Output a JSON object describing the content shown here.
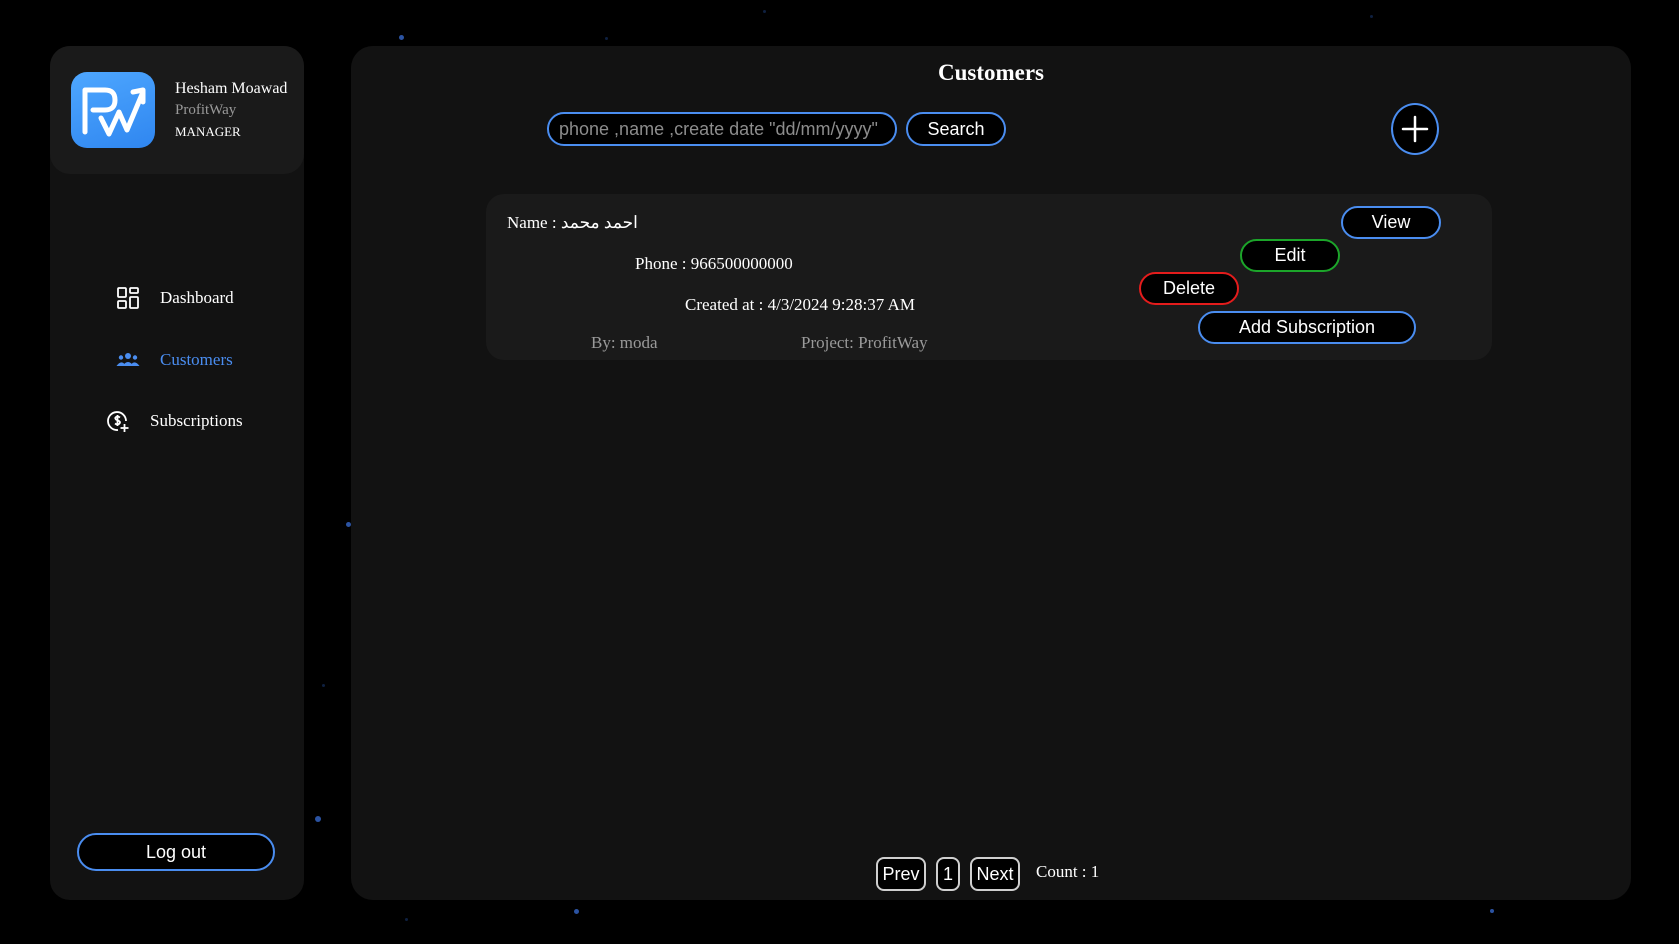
{
  "profile": {
    "name": "Hesham Moawad",
    "project": "ProfitWay",
    "role": "MANAGER"
  },
  "nav": {
    "items": [
      {
        "label": "Dashboard",
        "icon": "dashboard-grid-icon"
      },
      {
        "label": "Customers",
        "icon": "users-group-icon"
      },
      {
        "label": "Subscriptions",
        "icon": "dollar-plus-icon"
      }
    ],
    "active": "Customers",
    "logout_label": "Log out"
  },
  "page": {
    "title": "Customers",
    "search_placeholder": "phone ,name ,create date \"dd/mm/yyyy\"",
    "search_label": "Search",
    "add_icon": "plus-circle-icon"
  },
  "customers": [
    {
      "name_line": "Name : احمد محمد",
      "phone_line": "Phone : 966500000000",
      "created_line": "Created at : 4/3/2024 9:28:37 AM",
      "by_line": "By: moda",
      "project_line": "Project: ProfitWay",
      "actions": {
        "view": "View",
        "edit": "Edit",
        "delete": "Delete",
        "add_subscription": "Add Subscription"
      }
    }
  ],
  "pagination": {
    "prev": "Prev",
    "page": "1",
    "next": "Next",
    "count_text": "Count : 1"
  },
  "colors": {
    "accent": "#4a8df0",
    "edit": "#1ca52a",
    "delete": "#e41c1c",
    "panel": "#121212",
    "background": "#000000"
  }
}
